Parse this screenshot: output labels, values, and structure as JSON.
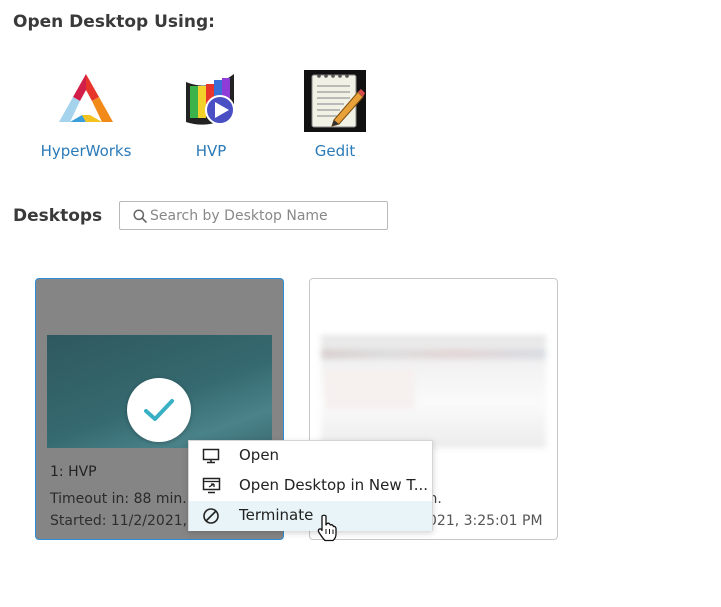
{
  "open_section": {
    "title": "Open Desktop Using:"
  },
  "apps": [
    {
      "label": "HyperWorks",
      "icon": "hyperworks-logo-icon"
    },
    {
      "label": "HVP",
      "icon": "hvp-film-play-icon"
    },
    {
      "label": "Gedit",
      "icon": "gedit-notepad-pencil-icon"
    }
  ],
  "desktops_section": {
    "title": "Desktops",
    "search": {
      "placeholder": "Search by Desktop Name",
      "value": ""
    }
  },
  "desktops": [
    {
      "name": "1: HVP",
      "timeout": "Timeout in: 88 min.",
      "started": "Started: 11/2/2021,",
      "selected": true
    },
    {
      "name": "",
      "timeout": "min.",
      "started": "021, 3:25:01 PM",
      "selected": false
    }
  ],
  "context_menu": {
    "items": [
      {
        "label": "Open",
        "icon": "monitor-icon"
      },
      {
        "label": "Open Desktop in New T...",
        "icon": "open-new-tab-icon"
      },
      {
        "label": "Terminate",
        "icon": "terminate-icon",
        "hovered": true
      }
    ]
  },
  "colors": {
    "accent_link": "#2a7ab8",
    "selected_border": "#2d8ed6",
    "check": "#3ab0c4",
    "menu_hover": "#e8f4f7"
  }
}
